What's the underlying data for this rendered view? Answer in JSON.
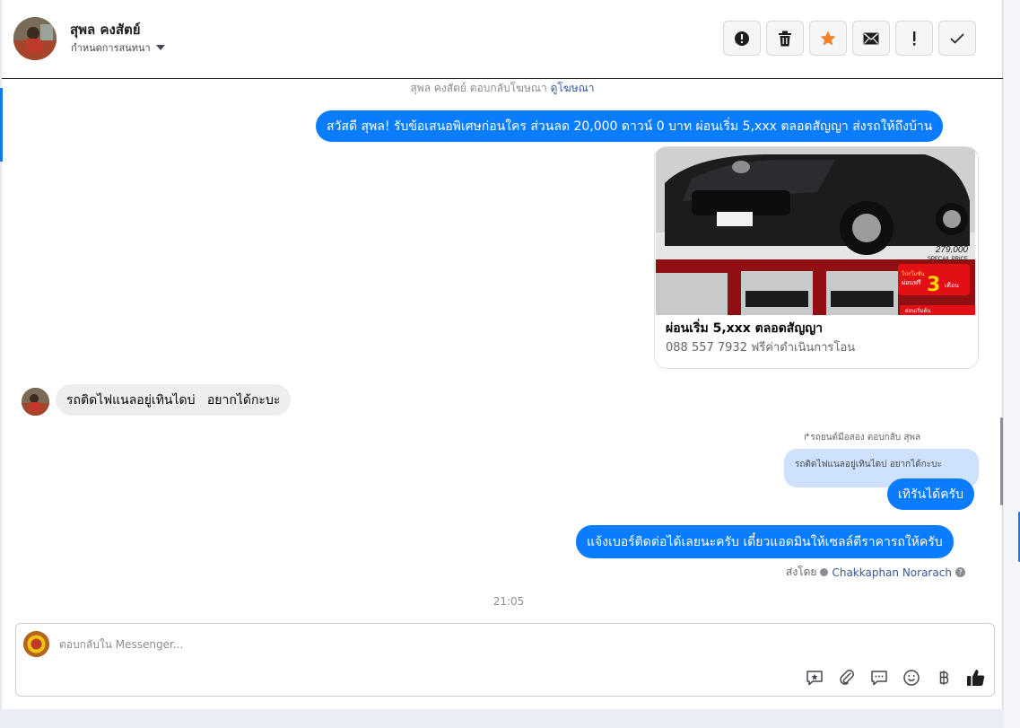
{
  "contact": {
    "name": "สุพล คงสัตย์",
    "assign_label": "กำหนดการสนทนา"
  },
  "header_actions": [
    {
      "name": "report-icon",
      "glyph": "!"
    },
    {
      "name": "trash-icon",
      "glyph": ""
    },
    {
      "name": "star-icon",
      "glyph": "★"
    },
    {
      "name": "envelope-icon",
      "glyph": ""
    },
    {
      "name": "exclamation-icon",
      "glyph": "!"
    },
    {
      "name": "check-icon",
      "glyph": "✓"
    }
  ],
  "ad_reply": {
    "text": "สุพล คงสัตย์ ตอบกลับโฆษณา",
    "link": "ดูโฆษณา"
  },
  "messages": {
    "m1": "สวัสดี สุพล! รับข้อเสนอพิเศษก่อนใคร ส่วนลด 20,000 ดาวน์ 0 บาท ผ่อนเริ่ม 5,xxx ตลอดสัญญา ส่งรถให้ถึงบ้าน",
    "card_title": "ผ่อนเริ่ม 5,xxx ตลอดสัญญา",
    "card_subtitle": "088 557 7932 ฟรีค่าดำเนินการโอน",
    "card_image": {
      "price": "279,000",
      "price_label": "SPECAIL PRICE",
      "promo_text": "โปรโมชั่น",
      "promo_free": "ผ่อนฟรี",
      "promo_number": "3",
      "promo_unit": "เดือน",
      "strip_text": "ผ่อนเริ่มต้น"
    },
    "m2": "รถติดไฟแนลอยู่เทินไดบ่   อยากได้กะบะ",
    "reply_meta": "รถยนต์มือสอง ตอบกลับ สุพล",
    "quoted": "รถติดไฟแนลอยู่เทินไดบ่ อยากได้กะบะ",
    "m3": "เทิรันได้ครับ",
    "m4": "แจ้งเบอร์ติดต่อได้เลยนะครับ เดี๋ยวแอดมินให้เซลล์ตีราคารถให้ครับ",
    "sent_by_label": "ส่งโดย",
    "sent_by_name": "Chakkaphan Norarach"
  },
  "timestamp": "21:05",
  "composer": {
    "placeholder": "ตอบกลับใน Messenger...",
    "tools": [
      "saved-reply-icon",
      "attachment-icon",
      "chat-icon",
      "emoji-icon",
      "baht-icon",
      "thumbs-up-icon"
    ]
  },
  "colors": {
    "accent": "#0a7cff",
    "star": "#f7812a"
  }
}
